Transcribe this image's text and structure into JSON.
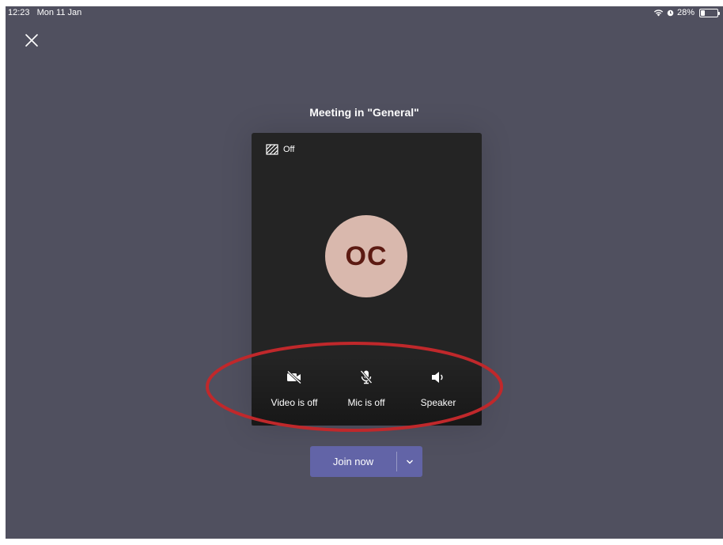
{
  "status_bar": {
    "time": "12:23",
    "date": "Mon 11 Jan",
    "battery": "28%"
  },
  "meeting": {
    "title": "Meeting in \"General\""
  },
  "background_effects": {
    "icon": "background-effects-icon",
    "label": "Off"
  },
  "avatar": {
    "initials": "OC",
    "bg_color": "#d9b8ad",
    "text_color": "#5c1a12"
  },
  "controls": {
    "video": {
      "icon": "video-off-icon",
      "label": "Video is off"
    },
    "mic": {
      "icon": "mic-off-icon",
      "label": "Mic is off"
    },
    "speaker": {
      "icon": "speaker-icon",
      "label": "Speaker"
    }
  },
  "join": {
    "label": "Join now",
    "dropdown_icon": "chevron-down-icon"
  },
  "colors": {
    "background": "#50505f",
    "accent": "#6264a7",
    "preview": "#242424",
    "highlight": "#c0282b"
  }
}
